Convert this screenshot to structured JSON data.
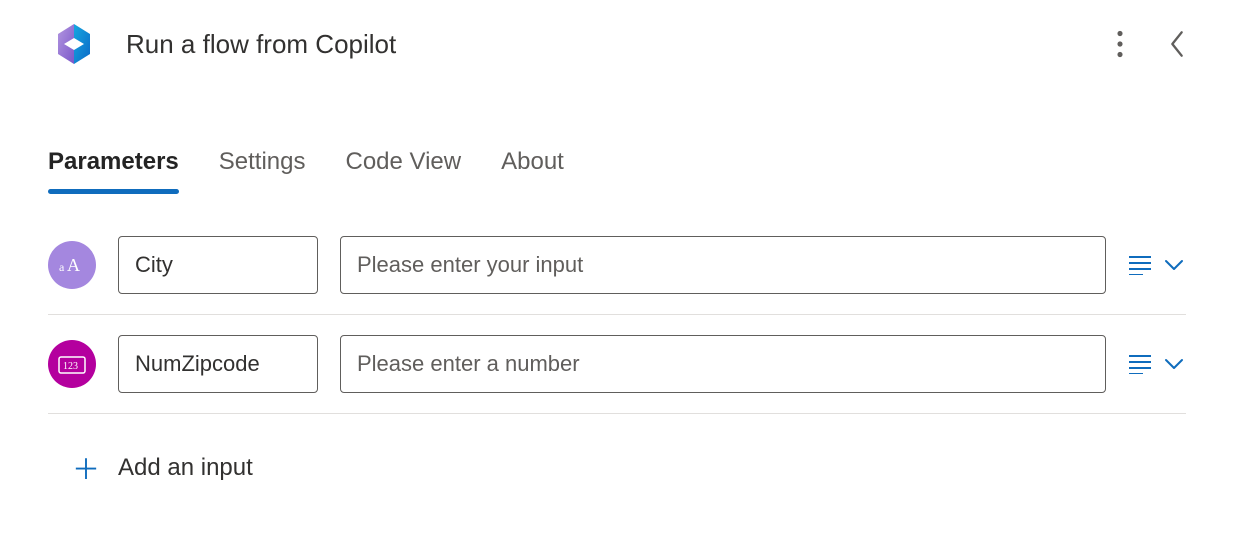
{
  "header": {
    "title": "Run a flow from Copilot"
  },
  "tabs": [
    {
      "label": "Parameters",
      "active": true
    },
    {
      "label": "Settings",
      "active": false
    },
    {
      "label": "Code View",
      "active": false
    },
    {
      "label": "About",
      "active": false
    }
  ],
  "params": [
    {
      "type": "text",
      "name": "City",
      "placeholder": "Please enter your input",
      "badge_color": "#a487df",
      "badge_icon": "text-icon"
    },
    {
      "type": "number",
      "name": "NumZipcode",
      "placeholder": "Please enter a number",
      "badge_color": "#b4009e",
      "badge_icon": "number-icon"
    }
  ],
  "add_input_label": "Add an input"
}
